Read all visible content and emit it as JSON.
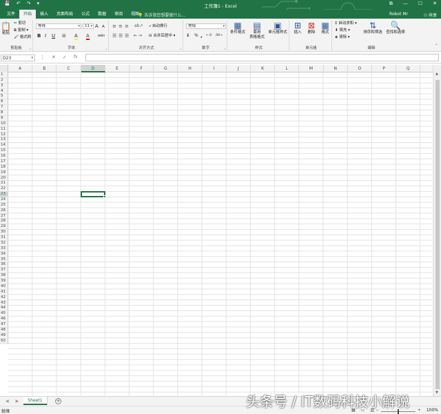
{
  "titlebar": {
    "title": "工作簿1 - Excel",
    "qat": {
      "save": "💾",
      "undo": "↶",
      "redo": "↷",
      "custom": "▾"
    },
    "win": {
      "restore": "⧉",
      "min": "—",
      "max": "☐",
      "close": "✕"
    }
  },
  "tabs": [
    "文件",
    "开始",
    "插入",
    "页面布局",
    "公式",
    "数据",
    "审阅",
    "视图"
  ],
  "tell_me": "告诉我您想要做什么...",
  "user": "Robot Mr",
  "share": "共享",
  "ribbon": {
    "clipboard": {
      "paste": "粘贴",
      "cut": "剪切",
      "copy": "复制 ▾",
      "painter": "格式刷",
      "label": "剪贴板"
    },
    "font": {
      "name": "等线",
      "size": "11",
      "grow": "A",
      "shrink": "A",
      "phonetic": "wén",
      "bold": "B",
      "italic": "I",
      "underline": "U",
      "border": "⊞",
      "fill": "A",
      "color": "A",
      "label": "字体"
    },
    "alignment": {
      "wrap": "自动换行",
      "merge": "合并后居中",
      "label": "对齐方式"
    },
    "number": {
      "format": "常规",
      "currency": "₤",
      "percent": "%",
      "comma": ",",
      "inc": "←.0",
      "dec": ".00→",
      "label": "数字"
    },
    "styles": {
      "conditional": "条件格式",
      "table1": "套用",
      "table2": "表格格式",
      "cell": "单元格样式",
      "label": "样式"
    },
    "cells": {
      "insert": "插入",
      "delete": "删除",
      "format": "格式",
      "label": "单元格"
    },
    "editing": {
      "autosum": "自动求和",
      "fill": "填充",
      "clear": "清除",
      "sort": "排序和筛选",
      "find": "查找和选择",
      "label": "编辑"
    }
  },
  "formula": {
    "namebox": "D23",
    "cancel": "✕",
    "enter": "✓",
    "fx": "fx",
    "value": ""
  },
  "columns": [
    "A",
    "B",
    "C",
    "D",
    "E",
    "F",
    "G",
    "H",
    "I",
    "J",
    "K",
    "L",
    "M",
    "N",
    "O",
    "P",
    "Q"
  ],
  "rows": [
    "1",
    "2",
    "3",
    "4",
    "5",
    "6",
    "7",
    "8",
    "9",
    "10",
    "11",
    "12",
    "13",
    "14",
    "15",
    "16",
    "17",
    "18",
    "19",
    "20",
    "21",
    "22",
    "23",
    "24",
    "25",
    "26",
    "27",
    "28",
    "29",
    "30",
    "31",
    "32",
    "33",
    "34",
    "35",
    "36",
    "37",
    "38",
    "39",
    "40",
    "41",
    "42",
    "43",
    "44",
    "45",
    "46",
    "47",
    "48",
    "49",
    "50"
  ],
  "selected_col": "D",
  "selected_row": "23",
  "sheet": {
    "name": "Sheet1",
    "add": "+"
  },
  "status": {
    "ready": "就绪",
    "zoom": "100%"
  },
  "watermark": "头条号 / IT数码科技小解说",
  "colors": {
    "accent": "#217346"
  }
}
